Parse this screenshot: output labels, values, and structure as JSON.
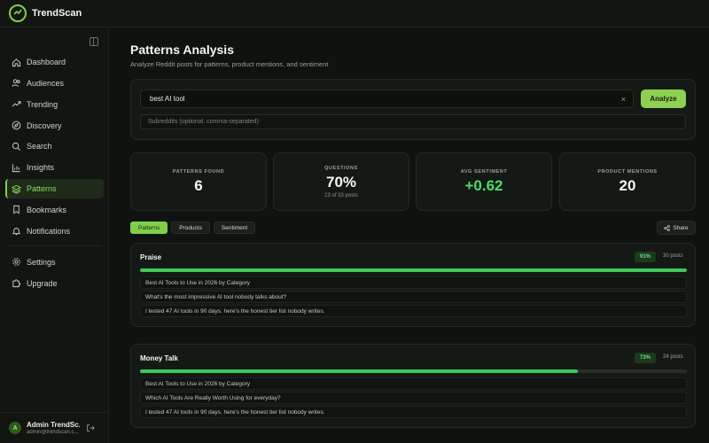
{
  "app": {
    "name": "TrendScan"
  },
  "sidebar": {
    "items": [
      {
        "label": "Dashboard",
        "icon": "home-icon"
      },
      {
        "label": "Audiences",
        "icon": "users-icon"
      },
      {
        "label": "Trending",
        "icon": "trending-icon"
      },
      {
        "label": "Discovery",
        "icon": "compass-icon"
      },
      {
        "label": "Search",
        "icon": "search-icon"
      },
      {
        "label": "Insights",
        "icon": "bar-chart-icon"
      },
      {
        "label": "Patterns",
        "icon": "layers-icon",
        "active": true
      },
      {
        "label": "Bookmarks",
        "icon": "bookmark-icon"
      },
      {
        "label": "Notifications",
        "icon": "bell-icon"
      }
    ],
    "bottom_items": [
      {
        "label": "Settings",
        "icon": "gear-icon"
      },
      {
        "label": "Upgrade",
        "icon": "puzzle-icon"
      }
    ],
    "user": {
      "initial": "A",
      "name": "Admin TrendSc...",
      "email": "admin@trendscan.c..."
    }
  },
  "page": {
    "title": "Patterns Analysis",
    "subtitle": "Analyze Reddit posts for patterns, product mentions, and sentiment"
  },
  "search": {
    "value": "best AI tool",
    "clear_label": "×",
    "analyze_label": "Analyze",
    "subreddits_placeholder": "Subreddits (optional, comma-separated)"
  },
  "stats": [
    {
      "label": "PATTERNS FOUND",
      "value": "6",
      "sub": ""
    },
    {
      "label": "QUESTIONS",
      "value": "70%",
      "sub": "23 of 33 posts"
    },
    {
      "label": "AVG SENTIMENT",
      "value": "+0.62",
      "sub": ""
    },
    {
      "label": "PRODUCT MENTIONS",
      "value": "20",
      "sub": ""
    }
  ],
  "tabs": [
    {
      "label": "Patterns",
      "active": true
    },
    {
      "label": "Products"
    },
    {
      "label": "Sentiment"
    }
  ],
  "share_label": "Share",
  "patterns": [
    {
      "title": "Praise",
      "percent_label": "91%",
      "fraction": 1.0,
      "count": "30 posts",
      "posts": [
        "Best AI Tools to Use in 2026 by Category",
        "What's the most impressive AI tool nobody talks about?",
        "I tested 47 AI tools in 90 days. here's the honest tier list nobody writes."
      ]
    },
    {
      "title": "Money Talk",
      "percent_label": "73%",
      "fraction": 0.8,
      "count": "24 posts",
      "posts": [
        "Best AI Tools to Use in 2026 by Category",
        "Which AI Tools Are Really Worth Using for everyday?",
        "I tested 47 AI tools in 90 days. here's the honest tier list nobody writes."
      ]
    }
  ],
  "colors": {
    "accent": "#8ed052",
    "positive": "#4fdc6a",
    "background": "#0f120f"
  }
}
